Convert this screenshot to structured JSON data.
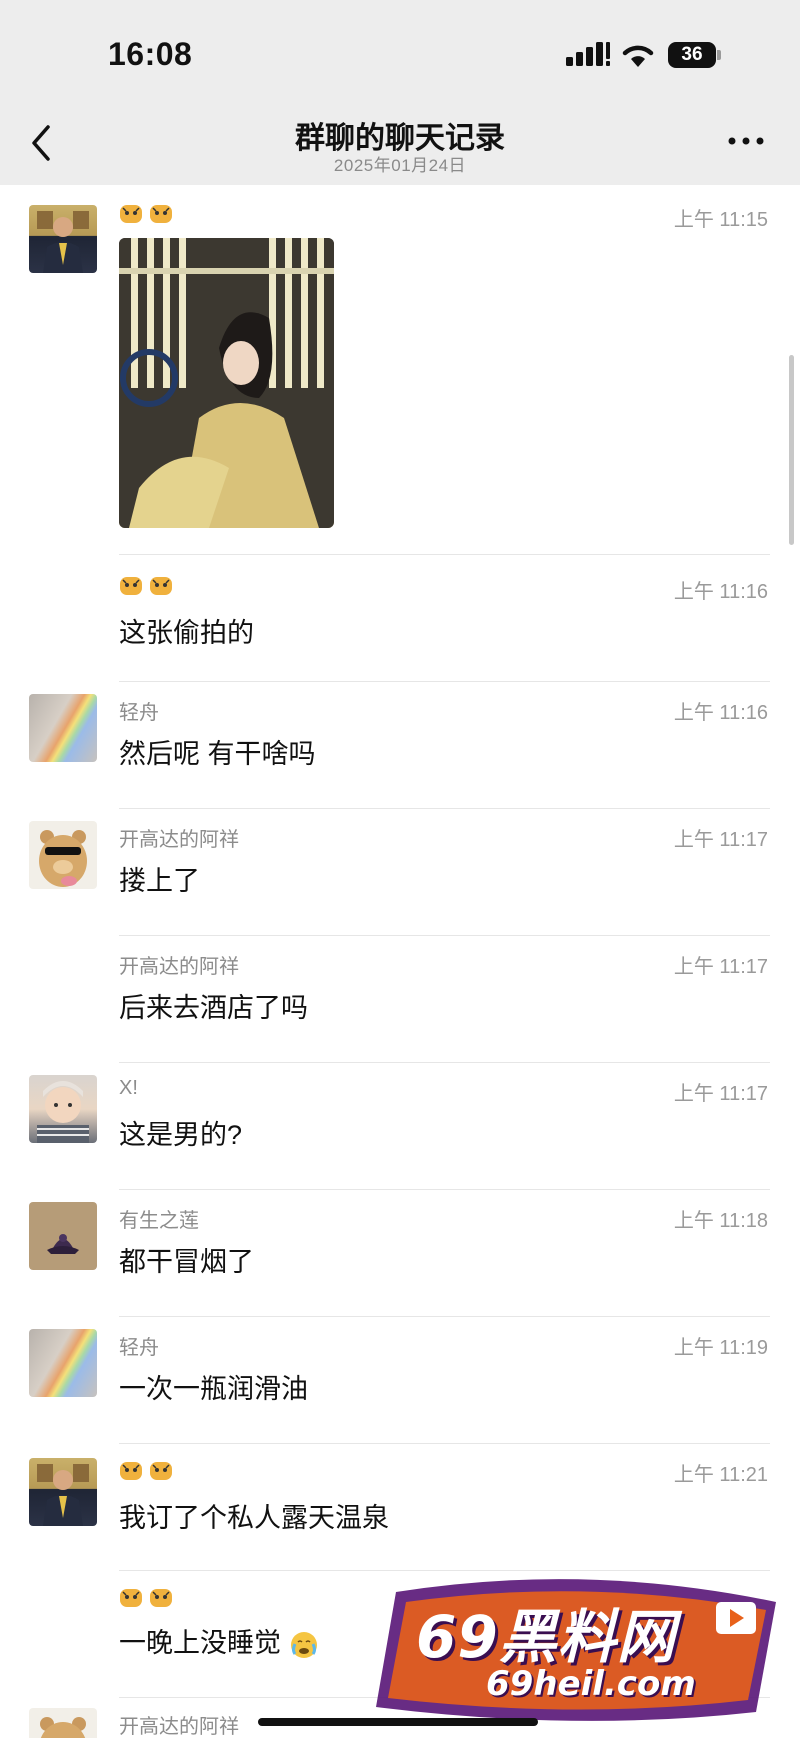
{
  "status_bar": {
    "time": "16:08",
    "battery_level": "36",
    "icons": [
      "signal-icon",
      "wifi-icon",
      "battery-icon"
    ]
  },
  "nav": {
    "title": "群聊的聊天记录",
    "subtitle": "2025年01月24日",
    "back_icon": "chevron-left-icon",
    "more_icon": "more-icon"
  },
  "messages": [
    {
      "sender": "🐯🐯",
      "time": "上午 11:15",
      "text": "",
      "type": "image",
      "avatar": "suit"
    },
    {
      "sender": "🐯🐯",
      "time": "上午 11:16",
      "text": "这张偷拍的",
      "avatar": ""
    },
    {
      "sender": "轻舟",
      "time": "上午 11:16",
      "text": "然后呢 有干啥吗",
      "avatar": "rainbow"
    },
    {
      "sender": "开高达的阿祥",
      "time": "上午 11:17",
      "text": "搂上了",
      "avatar": "bear"
    },
    {
      "sender": "开高达的阿祥",
      "time": "上午 11:17",
      "text": "后来去酒店了吗",
      "avatar": ""
    },
    {
      "sender": "X!",
      "time": "上午 11:17",
      "text": "这是男的?",
      "avatar": "child"
    },
    {
      "sender": "有生之莲",
      "time": "上午 11:18",
      "text": "都干冒烟了",
      "avatar": "lotus"
    },
    {
      "sender": "轻舟",
      "time": "上午 11:19",
      "text": "一次一瓶润滑油",
      "avatar": "rainbow"
    },
    {
      "sender": "🐯🐯",
      "time": "上午 11:21",
      "text": "我订了个私人露天温泉",
      "avatar": "suit"
    },
    {
      "sender": "🐯🐯",
      "time": "",
      "text": "一晚上没睡觉",
      "avatar": ""
    },
    {
      "sender": "开高达的阿祥",
      "time": "",
      "text": "",
      "avatar": "bear"
    }
  ],
  "watermark": {
    "brand": "69黑料网",
    "url": "69heil.com"
  },
  "colors": {
    "header_bg": "#ededed",
    "watermark_orange": "#e8611a",
    "watermark_purple": "#5b1a7a"
  }
}
